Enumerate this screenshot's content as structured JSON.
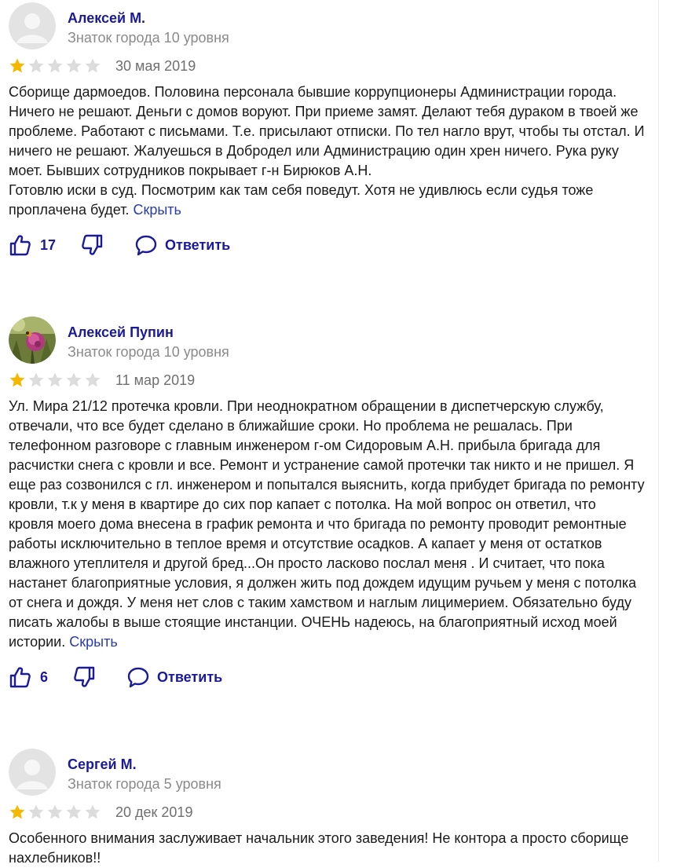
{
  "colors": {
    "author": "#1a1a9a",
    "rank": "#8a8a8a",
    "star_filled": "#f5b800",
    "star_empty": "#dcdcdc",
    "link": "#2a3bb0"
  },
  "reviews": [
    {
      "author": "Алексей М.",
      "rank": "Знаток города 10 уровня",
      "rating": 1,
      "date": "30 мая 2019",
      "paragraphs": [
        "Сборище дармоедов. Половина персонала бывшие коррупционеры Администрации города. Ничего не решают. Деньги с домов воруют. При приеме замят. Делают тебя дураком в твоей же проблеме. Работают с письмами. Т.е. присылают отписки. По тел нагло врут, чтобы ты отстал. И ничего не решают. Жалуешься в Добродел или Администрацию один хрен ничего. Рука руку моет. Бывших сотрудников покрывает г-н Бирюков А.Н.",
        "Готовлю иски в суд. Посмотрим как там себя поведут. Хотя не удивлюсь если судья тоже проплачена будет."
      ],
      "hide_label": "Скрыть",
      "likes": "17",
      "reply_label": "Ответить",
      "avatar": "default-avatar"
    },
    {
      "author": "Алексей Пупин",
      "rank": "Знаток города 10 уровня",
      "rating": 1,
      "date": "11 мар 2019",
      "paragraphs": [
        "Ул. Мира 21/12 протечка кровли. При неоднократном обращении в диспетчерскую службу, отвечали, что все будет сделано в ближайшие сроки. Но проблема не решалась. При телефонном разговоре с главным инженером г-ом Сидоровым А.Н. прибыла бригада для расчистки снега с кровли и все. Ремонт и устранение самой протечки так никто и не пришел. Я еще раз созвонился с гл. инженером и попытался выяснить, когда прибудет бригада по ремонту кровли, т.к у меня в квартире до сих пор капает с потолка. На мой вопрос он ответил, что кровля моего дома внесена в график ремонта и что бригада по ремонту проводит ремонтные работы исключительно в теплое время и отсутствие осадков. А капает у меня от остатков влажного утеплителя и другой бред...Он просто ласково послал меня . И считает, что пока настанет благоприятные условия, я должен жить под дождем идущим ручьем у меня с потолка от снега и дождя. У меня нет слов с таким хамством и наглым лицимерием. Обязательно буду писать жалобы в выше стоящие инстанции. ОЧЕНЬ надеюсь, на благоприятный исход моей истории."
      ],
      "hide_label": "Скрыть",
      "likes": "6",
      "reply_label": "Ответить",
      "avatar": "flower-photo-avatar"
    },
    {
      "author": "Сергей М.",
      "rank": "Знаток города 5 уровня",
      "rating": 1,
      "date": "20 дек 2019",
      "paragraphs": [
        "Особенного внимания заслуживает начальник этого заведения! Не контора а просто сборище нахлебников!!"
      ],
      "avatar": "default-avatar"
    }
  ]
}
